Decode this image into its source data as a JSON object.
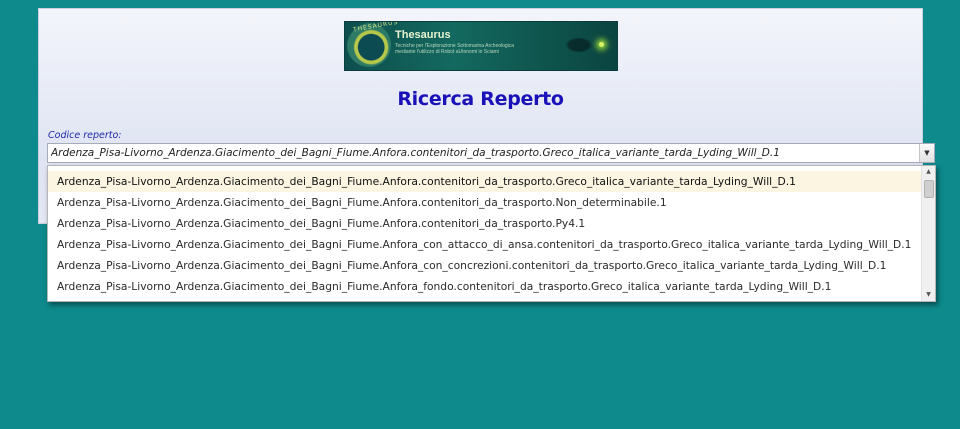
{
  "logo": {
    "name": "Thesaurus",
    "emblem_text": "THESAURUS",
    "tagline": "Tecniche per l'Esplorazione Sottomarina Archeologica\nmediante l'utilizzo di Robot aUtonomi in Sciami"
  },
  "page": {
    "title": "Ricerca Reperto"
  },
  "search": {
    "label": "Codice reperto:",
    "value": "Ardenza_Pisa-Livorno_Ardenza.Giacimento_dei_Bagni_Fiume.Anfora.contenitori_da_trasporto.Greco_italica_variante_tarda_Lyding_Will_D.1"
  },
  "dropdown": {
    "options": [
      "Ardenza_Pisa-Livorno_Ardenza.Giacimento_dei_Bagni_Fiume.Anfora.contenitori_da_trasporto.Greco_italica_variante_tarda_Lyding_Will_D.1",
      "Ardenza_Pisa-Livorno_Ardenza.Giacimento_dei_Bagni_Fiume.Anfora.contenitori_da_trasporto.Non_determinabile.1",
      "Ardenza_Pisa-Livorno_Ardenza.Giacimento_dei_Bagni_Fiume.Anfora.contenitori_da_trasporto.Py4.1",
      "Ardenza_Pisa-Livorno_Ardenza.Giacimento_dei_Bagni_Fiume.Anfora_con_attacco_di_ansa.contenitori_da_trasporto.Greco_italica_variante_tarda_Lyding_Will_D.1",
      "Ardenza_Pisa-Livorno_Ardenza.Giacimento_dei_Bagni_Fiume.Anfora_con_concrezioni.contenitori_da_trasporto.Greco_italica_variante_tarda_Lyding_Will_D.1",
      "Ardenza_Pisa-Livorno_Ardenza.Giacimento_dei_Bagni_Fiume.Anfora_fondo.contenitori_da_trasporto.Greco_italica_variante_tarda_Lyding_Will_D.1"
    ],
    "selected_index": 0
  },
  "colors": {
    "background": "#0e8a8c",
    "title": "#1a12b8",
    "label": "#1f2aa8",
    "selected_row": "#fbf5e1"
  },
  "icons": {
    "combo_arrow": "chevron-down-icon",
    "scroll_up": "scroll-up-icon",
    "scroll_down": "scroll-down-icon"
  }
}
